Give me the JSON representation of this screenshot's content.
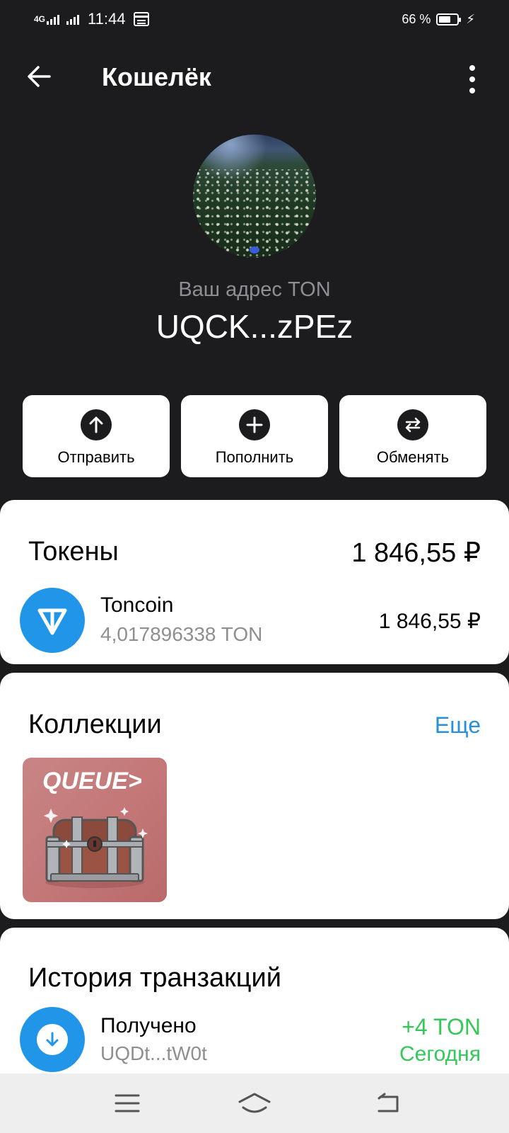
{
  "status_bar": {
    "network": "4G",
    "time": "11:44",
    "battery_text": "66 %",
    "battery_level": 0.66
  },
  "app_bar": {
    "title": "Кошелёк",
    "back_icon": "arrow-left-icon",
    "menu_icon": "more-vertical-icon"
  },
  "wallet": {
    "address_label": "Ваш адрес TON",
    "address": "UQCK...zPEz"
  },
  "actions": [
    {
      "label": "Отправить",
      "icon": "arrow-up-icon"
    },
    {
      "label": "Пополнить",
      "icon": "plus-icon"
    },
    {
      "label": "Обменять",
      "icon": "swap-icon"
    }
  ],
  "tokens": {
    "title": "Токены",
    "total": "1 846,55 ₽",
    "items": [
      {
        "name": "Toncoin",
        "amount": "4,017896338 TON",
        "value": "1 846,55 ₽",
        "icon": "ton-logo-icon"
      }
    ]
  },
  "collections": {
    "title": "Коллекции",
    "more_label": "Еще",
    "items": [
      {
        "brand": "QUEUE>",
        "image": "treasure-chest"
      }
    ]
  },
  "history": {
    "title": "История транзакций",
    "items": [
      {
        "title": "Получено",
        "address": "UQDt...tW0t",
        "amount": "+4 TON",
        "date": "Сегодня",
        "icon": "arrow-down-icon"
      }
    ]
  },
  "colors": {
    "background": "#1c1c1e",
    "card": "#ffffff",
    "accent_blue": "#2196e8",
    "link_blue": "#2a8fd9",
    "positive_green": "#34c759",
    "secondary_text": "#8e8e93"
  }
}
